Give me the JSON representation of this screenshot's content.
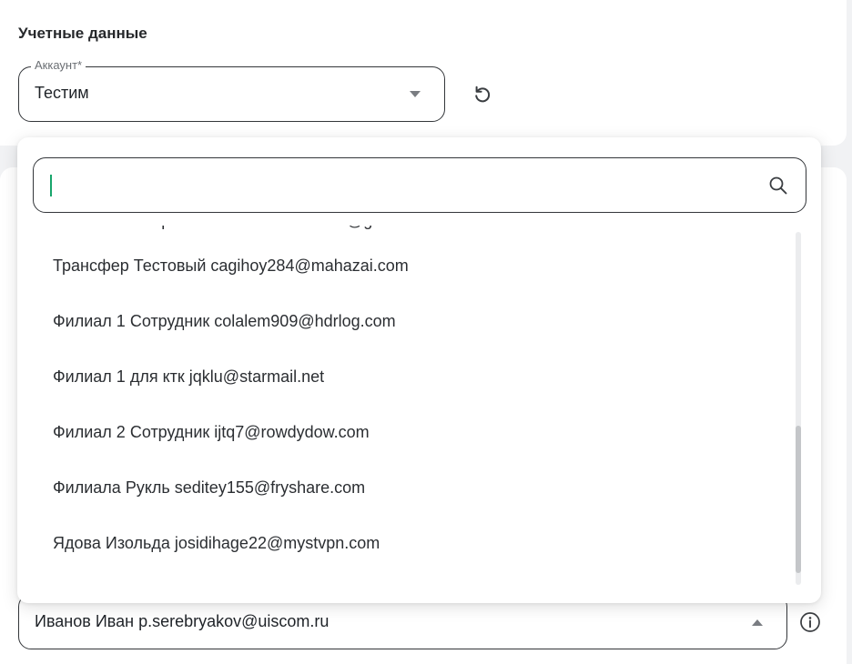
{
  "credentials": {
    "title": "Учетные данные",
    "account_field": {
      "label": "Аккаунт*",
      "value": "Тестим"
    }
  },
  "dropdown": {
    "search": {
      "value": "",
      "placeholder": ""
    },
    "options": [
      "ПочтаоISВВитре КолятеСт mammamia@gmail.ru",
      "Трансфер Тестовый cagihoy284@mahazai.com",
      "Филиал 1 Сотрудник colalem909@hdrlog.com",
      "Филиал 1 для ктк jqklu@starmail.net",
      "Филиал 2 Сотрудник ijtq7@rowdydow.com",
      "Филиала Рукль seditey155@fryshare.com",
      "Ядова Изольда josidihage22@mystvpn.com"
    ]
  },
  "user_field": {
    "value": "Иванов Иван p.serebryakov@uiscom.ru"
  },
  "icons": {
    "reset": "refresh-icon",
    "search": "search-icon",
    "info": "info-icon",
    "dropdown_arrow": "chevron-down-icon",
    "dropup_arrow": "chevron-up-icon"
  },
  "colors": {
    "border": "#33363a",
    "caret": "#18a56b",
    "background": "#f1f2f4"
  }
}
